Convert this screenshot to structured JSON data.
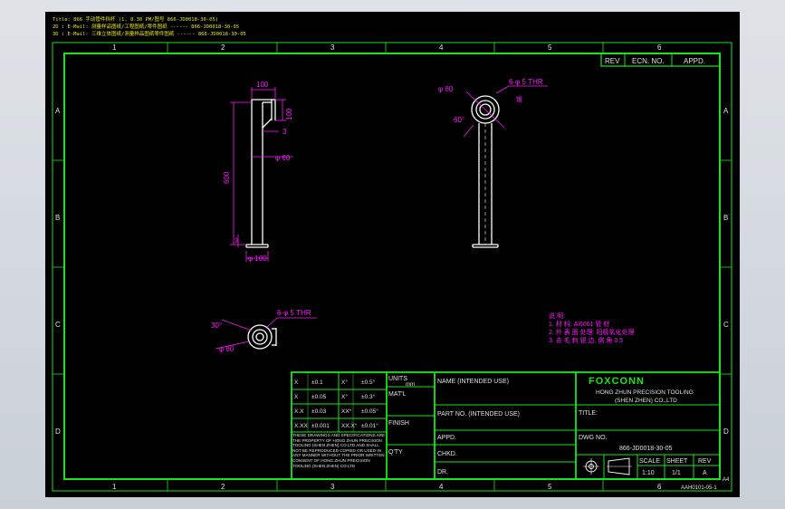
{
  "header_notes": [
    "Title: 866 手动管件挡杆 (1, 8.30 PM/图号 866-JD0018-30-05)",
    "2D : E-Mail: 测量样品图纸/工程图纸/零件图纸 ------ 866-JD0018-30-05",
    "3D : E-Mail: 三维立体图纸/测量样品图纸零件图纸 ------ 866-JD0018-30-05"
  ],
  "grid": {
    "columns": [
      "1",
      "2",
      "3",
      "4",
      "5",
      "6"
    ],
    "rows": [
      "A",
      "B",
      "C",
      "D"
    ]
  },
  "revision_table": {
    "rev": "REV",
    "ecn": "ECN. NO.",
    "appd": "APPD."
  },
  "dimensions": {
    "top_width": "100",
    "side_height": "100",
    "step": "3",
    "tube_dia": "φ 60",
    "length": "600",
    "foot_step": "3",
    "base_dia": "φ 100",
    "top_view_dia": "φ 80",
    "top_view_holes": "6-φ 5 THR",
    "top_view_mark": "锥",
    "top_view_angle": "60°",
    "bottom_view_holes": "6-φ 5 THR",
    "bottom_view_angle": "30°",
    "bottom_view_dia": "φ 80"
  },
  "notes": [
    "说 明:",
    "1. 材 料: Al6061    管 材",
    "2. 外 表 面 处理: 阳极氧化处理",
    "3. 去 毛 刺 锐 边, 倒 角 0.5"
  ],
  "tolerance_table": [
    [
      "X",
      "±0.1",
      "X°",
      "±0.5°"
    ],
    [
      "X",
      "±0.05",
      "X°",
      "±0.3°"
    ],
    [
      "X.X",
      "±0.03",
      "XX°",
      "±0.05°"
    ],
    [
      "X.XX",
      "±0.001",
      "XX.X°",
      "±0.01°"
    ]
  ],
  "proprietary_text": "THESE DRAWINGS AND SPECIFICATIONS ARE THE PROPERTY OF HONG ZHUN PRECISION TOOLING (SHEN ZHEN) CO LTD AND SHALL NOT BE REPRODUCED COPIED OR USED IN ANY MANNER WITHOUT THE PRIOR WRITTEN CONSENT OF HONG ZHUN PRECISION TOOLING (SHEN ZHEN) CO LTD",
  "title_block": {
    "units_label": "UNITS",
    "units_value": "mm",
    "matl": "MAT'L",
    "finish": "FINISH",
    "qty": "Q'TY",
    "name": "NAME (INTENDED USE)",
    "part_no": "PART NO. (INTENDED USE)",
    "appd": "APPD.",
    "chkd": "CHKD.",
    "dr": "DR.",
    "company_logo": "FOXCONN",
    "company_line1": "HONG ZHUN PRECISION TOOLING",
    "company_line2": "(SHEN ZHEN) CO.,LTD",
    "title_label": "TITLE:",
    "dwg_label": "DWG NO.",
    "dwg_no": "866-JD0018-30-05",
    "scale_label": "SCALE",
    "scale_value": "1:10",
    "sheet_label": "SHEET",
    "sheet_value": "1/1",
    "rev_label": "REV",
    "rev_value": "A",
    "paper_size": "A4",
    "form_no": "AAH0101-05-1"
  },
  "colors": {
    "border": "#19e619",
    "dimension": "#ff19ff",
    "part": "#ffffff",
    "background": "#000000"
  }
}
